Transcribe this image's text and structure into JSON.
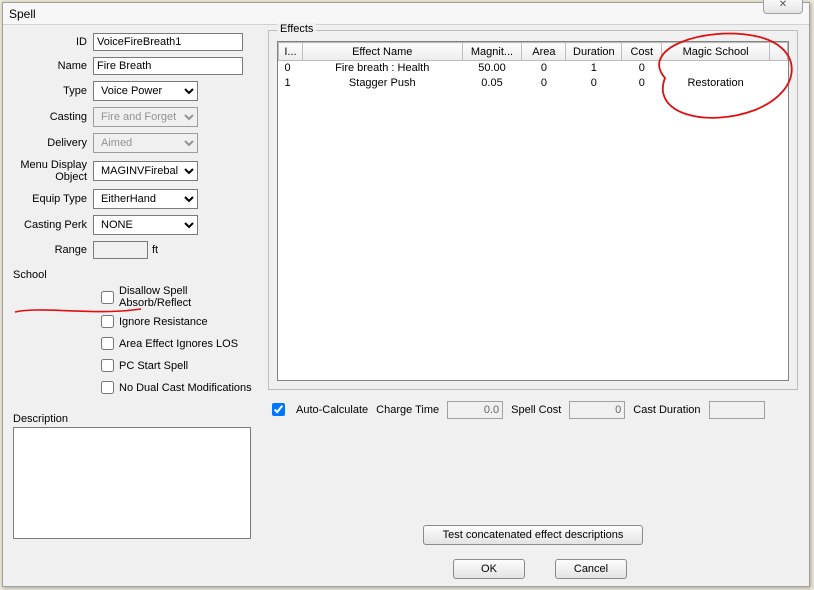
{
  "window": {
    "title": "Spell",
    "close_glyph": "✕"
  },
  "labels": {
    "id": "ID",
    "name": "Name",
    "type": "Type",
    "casting": "Casting",
    "delivery": "Delivery",
    "menu_display_object": "Menu Display Object",
    "equip_type": "Equip Type",
    "casting_perk": "Casting Perk",
    "range": "Range",
    "range_unit": "ft",
    "school": "School",
    "description": "Description",
    "effects_group": "Effects",
    "auto_calculate": "Auto-Calculate",
    "charge_time": "Charge Time",
    "spell_cost": "Spell Cost",
    "cast_duration": "Cast Duration",
    "btn_test": "Test concatenated effect descriptions",
    "btn_ok": "OK",
    "btn_cancel": "Cancel"
  },
  "fields": {
    "id": "VoiceFireBreath1",
    "name": "Fire Breath",
    "type": "Voice Power",
    "casting": "Fire and Forget",
    "delivery": "Aimed",
    "menu_display_object": "MAGINVFireballArt",
    "equip_type": "EitherHand",
    "casting_perk": "NONE",
    "range": "",
    "description": ""
  },
  "checkboxes": {
    "disallow": {
      "label": "Disallow Spell Absorb/Reflect",
      "checked": false
    },
    "ignore_res": {
      "label": "Ignore Resistance",
      "checked": false
    },
    "aoe_los": {
      "label": "Area Effect Ignores LOS",
      "checked": false
    },
    "pc_start": {
      "label": "PC Start Spell",
      "checked": false
    },
    "no_dual": {
      "label": "No Dual Cast Modifications",
      "checked": false
    }
  },
  "effects": {
    "columns": [
      "I...",
      "Effect Name",
      "Magnit...",
      "Area",
      "Duration",
      "Cost",
      "Magic School"
    ],
    "rows": [
      {
        "idx": "0",
        "name": "Fire breath : Health",
        "magnitude": "50.00",
        "area": "0",
        "duration": "1",
        "cost": "0",
        "school": ""
      },
      {
        "idx": "1",
        "name": "Stagger Push",
        "magnitude": "0.05",
        "area": "0",
        "duration": "0",
        "cost": "0",
        "school": "Restoration"
      }
    ]
  },
  "calc": {
    "auto_calculate_checked": true,
    "charge_time": "0.0",
    "spell_cost": "0",
    "cast_duration": ""
  }
}
